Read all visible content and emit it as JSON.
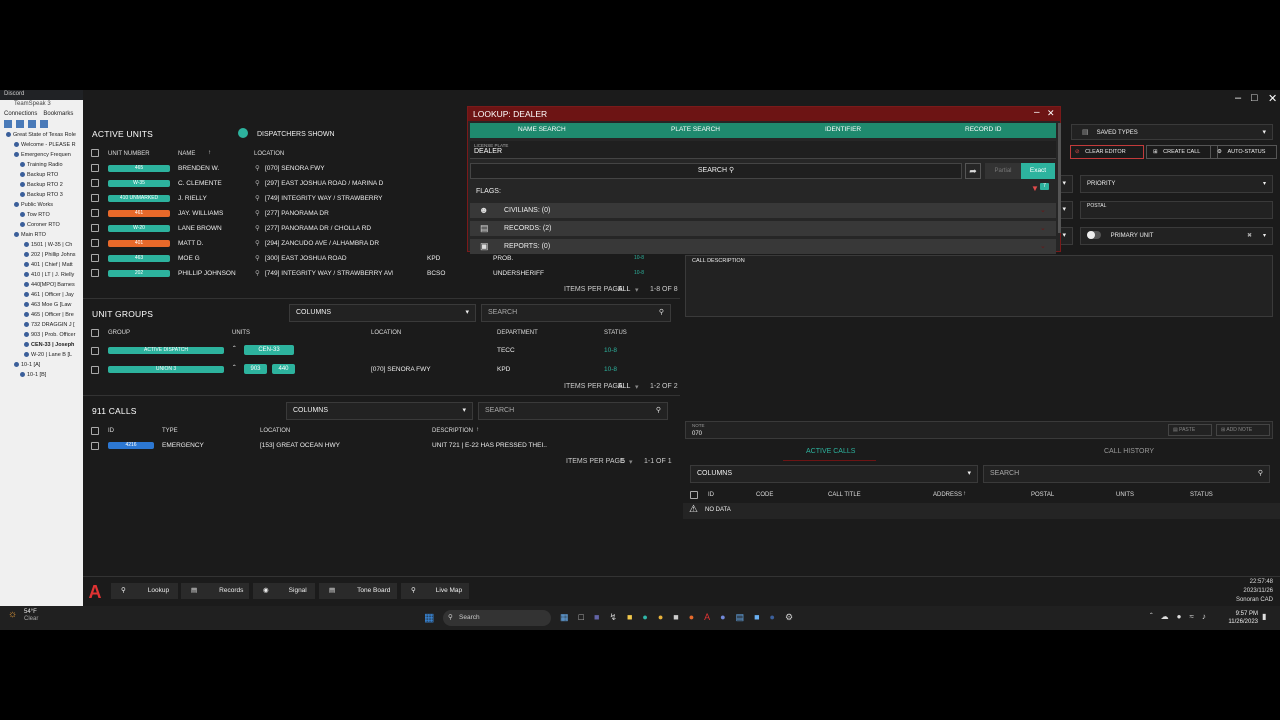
{
  "teamspeak": {
    "discord_label": "Discord",
    "title": "TeamSpeak 3",
    "menu": [
      "Connections",
      "Bookmarks"
    ],
    "tree": [
      "Great State of Texas Role",
      "Welcome - PLEASE R",
      "Emergency Frequen",
      "Training Radio",
      "Backup RTO",
      "Backup RTO 2",
      "Backup RTO 3",
      "Public Works",
      "Tow RTO",
      "Coroner RTO",
      "Main RTO",
      "1501 | W-35 | Ch",
      "202 | Phillip Johns",
      "401 | Chief | Matt",
      "410 | LT | J. Rielly",
      "440[MPO] Barnes",
      "461 | Officer | Jay",
      "463 Moe G [Law",
      "465 | Officer | Bre",
      "732 DRAGGIN J [",
      "903 | Prob. Officer",
      "CEN-33 | Joseph",
      "W-20 | Lane B [L",
      "10-1 [A]",
      "10-1 [B]"
    ]
  },
  "active_units": {
    "title": "ACTIVE UNITS",
    "dispatchers_label": "DISPATCHERS SHOWN",
    "col_unit": "UNIT NUMBER",
    "col_name": "NAME",
    "col_location": "LOCATION",
    "rows": [
      {
        "unit": "465",
        "name": "BRENDEN W.",
        "location": "[070] SENORA FWY",
        "dept": "",
        "rank": "",
        "status": "",
        "color": "#2db39e"
      },
      {
        "unit": "W-35",
        "name": "C. CLEMENTE",
        "location": "[297] EAST JOSHUA ROAD / MARINA D",
        "dept": "",
        "rank": "",
        "status": "",
        "color": "#2db39e"
      },
      {
        "unit": "410 UNMARKED",
        "name": "J. RIELLY",
        "location": "[749] INTEGRITY WAY / STRAWBERRY",
        "dept": "",
        "rank": "",
        "status": "",
        "color": "#2db39e"
      },
      {
        "unit": "461",
        "name": "JAY. WILLIAMS",
        "location": "[277] PANORAMA DR",
        "dept": "",
        "rank": "",
        "status": "",
        "color": "#e8692a"
      },
      {
        "unit": "W-20",
        "name": "LANE BROWN",
        "location": "[277] PANORAMA DR / CHOLLA RD",
        "dept": "",
        "rank": "",
        "status": "",
        "color": "#2db39e"
      },
      {
        "unit": "401",
        "name": "MATT D.",
        "location": "[294] ZANCUDO AVE / ALHAMBRA DR",
        "dept": "",
        "rank": "",
        "status": "",
        "color": "#e8692a"
      },
      {
        "unit": "463",
        "name": "MOE G",
        "location": "[300] EAST JOSHUA ROAD",
        "dept": "KPD",
        "rank": "PROB.",
        "status": "10-8",
        "color": "#2db39e"
      },
      {
        "unit": "202",
        "name": "PHILLIP JOHNSON",
        "location": "[749] INTEGRITY WAY / STRAWBERRY AVE",
        "dept": "BCSO",
        "rank": "UNDERSHERIFF",
        "status": "10-8",
        "color": "#2db39e"
      }
    ],
    "items_per_page": "ITEMS PER PAGE",
    "ipp_value": "ALL",
    "range": "1-8 OF 8"
  },
  "unit_groups": {
    "title": "UNIT GROUPS",
    "columns_label": "COLUMNS",
    "search_placeholder": "SEARCH",
    "col_group": "GROUP",
    "col_units": "UNITS",
    "col_location": "LOCATION",
    "col_department": "DEPARTMENT",
    "col_status": "STATUS",
    "rows": [
      {
        "group": "ACTIVE DISPATCH",
        "units": [
          "CEN-33"
        ],
        "location": "",
        "department": "TECC",
        "status": "10-8"
      },
      {
        "group": "UNION 3",
        "units": [
          "903",
          "440"
        ],
        "location": "[070] SENORA FWY",
        "department": "KPD",
        "status": "10-8"
      }
    ],
    "items_per_page": "ITEMS PER PAGE",
    "ipp_value": "ALL",
    "range": "1-2 OF 2"
  },
  "calls_911": {
    "title": "911 CALLS",
    "columns_label": "COLUMNS",
    "search_placeholder": "SEARCH",
    "col_id": "ID",
    "col_type": "TYPE",
    "col_location": "LOCATION",
    "col_description": "DESCRIPTION",
    "rows": [
      {
        "id": "4216",
        "type": "EMERGENCY",
        "location": "[153] GREAT OCEAN HWY",
        "description": "UNIT 721 | E-22 HAS PRESSED THEI.."
      }
    ],
    "items_per_page": "ITEMS PER PAGE",
    "ipp_value": "5",
    "range": "1-1 OF 1"
  },
  "lookup": {
    "title": "LOOKUP: DEALER",
    "tabs": [
      "NAME SEARCH",
      "PLATE SEARCH",
      "IDENTIFIER",
      "RECORD ID"
    ],
    "plate_label": "LICENSE PLATE",
    "plate_value": "DEALER",
    "search_label": "SEARCH",
    "partial_label": "Partial",
    "exact_label": "Exact",
    "flags_label": "FLAGS:",
    "flag_count": "7",
    "civilians": "CIVILIANS: (0)",
    "records": "RECORDS: (2)",
    "reports": "REPORTS: (0)"
  },
  "editor": {
    "saved_types": "SAVED TYPES",
    "clear_editor": "CLEAR EDITOR",
    "create_call": "CREATE CALL",
    "auto_status": "AUTO-STATUS",
    "priority": "PRIORITY",
    "postal_label": "POSTAL",
    "primary_unit": "PRIMARY UNIT",
    "call_description": "CALL DESCRIPTION",
    "note_label": "NOTE",
    "note_value": "070",
    "paste": "PASTE",
    "add_note": "ADD NOTE"
  },
  "calls_panel": {
    "tab_active": "ACTIVE CALLS",
    "tab_history": "CALL HISTORY",
    "columns_label": "COLUMNS",
    "search_placeholder": "SEARCH",
    "col_id": "ID",
    "col_code": "CODE",
    "col_title": "CALL TITLE",
    "col_address": "ADDRESS",
    "col_postal": "POSTAL",
    "col_units": "UNITS",
    "col_status": "STATUS",
    "no_data": "NO DATA"
  },
  "dock": {
    "buttons": [
      "Lookup",
      "Records",
      "Signal",
      "Tone Board",
      "Live Map"
    ],
    "time": "22:57:48",
    "date": "2023/11/26",
    "brand": "Sonoran CAD"
  },
  "taskbar": {
    "weather_temp": "54°F",
    "weather_text": "Clear",
    "search_placeholder": "Search",
    "time": "9:57 PM",
    "date": "11/26/2023"
  },
  "colors": {
    "teal": "#2db39e",
    "orange": "#e8692a",
    "blue": "#2c77d2",
    "lookup_red": "#6d1414",
    "lookup_tab_green": "#1f8a6e"
  }
}
